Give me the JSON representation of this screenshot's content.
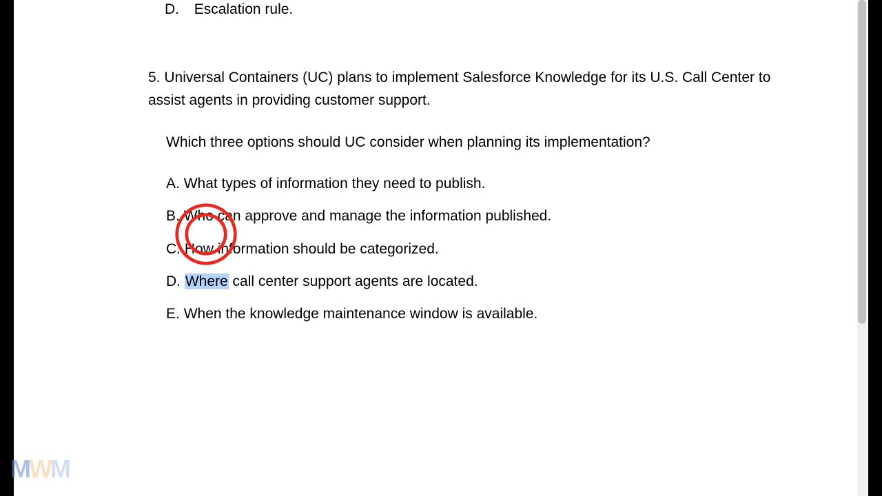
{
  "prevQuestion": {
    "optionD": {
      "letter": "D.",
      "text": "Escalation rule."
    }
  },
  "question5": {
    "number": "5.",
    "text": "Universal Containers (UC) plans to implement Salesforce Knowledge for its U.S. Call Center to assist agents in providing customer support.",
    "subQuestion": "Which three options should UC consider when planning its implementation?",
    "options": {
      "A": {
        "letter": "A.",
        "text": "What types of information they need to publish."
      },
      "B": {
        "letter": "B.",
        "text": "Who can approve and manage the information published."
      },
      "C": {
        "letter": "C.",
        "text": "How information should be categorized."
      },
      "D": {
        "letter": "D.",
        "highlighted": "Where",
        "rest": " call center support agents are located."
      },
      "E": {
        "letter": "E.",
        "text": "When the knowledge maintenance window is available."
      }
    }
  },
  "watermark": {
    "m1": "M",
    "w": "W",
    "m2": "M"
  }
}
